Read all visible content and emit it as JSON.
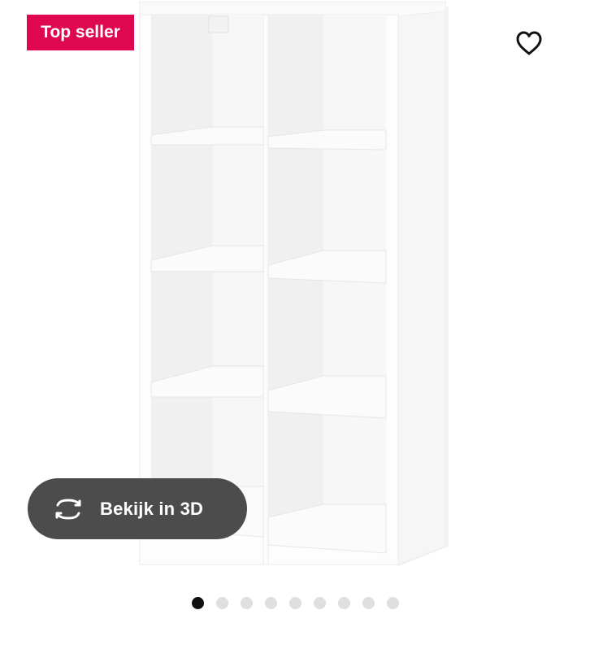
{
  "badge": {
    "label": "Top seller",
    "color": "#e00751"
  },
  "favourite": {
    "icon": "heart-icon"
  },
  "view_3d": {
    "label": "Bekijk in 3D",
    "icon": "rotate-360-icon",
    "background": "#4c4c4c"
  },
  "product_image": {
    "subject": "white-cube-shelving-unit-4x2"
  },
  "carousel": {
    "total": 9,
    "active_index": 0
  }
}
